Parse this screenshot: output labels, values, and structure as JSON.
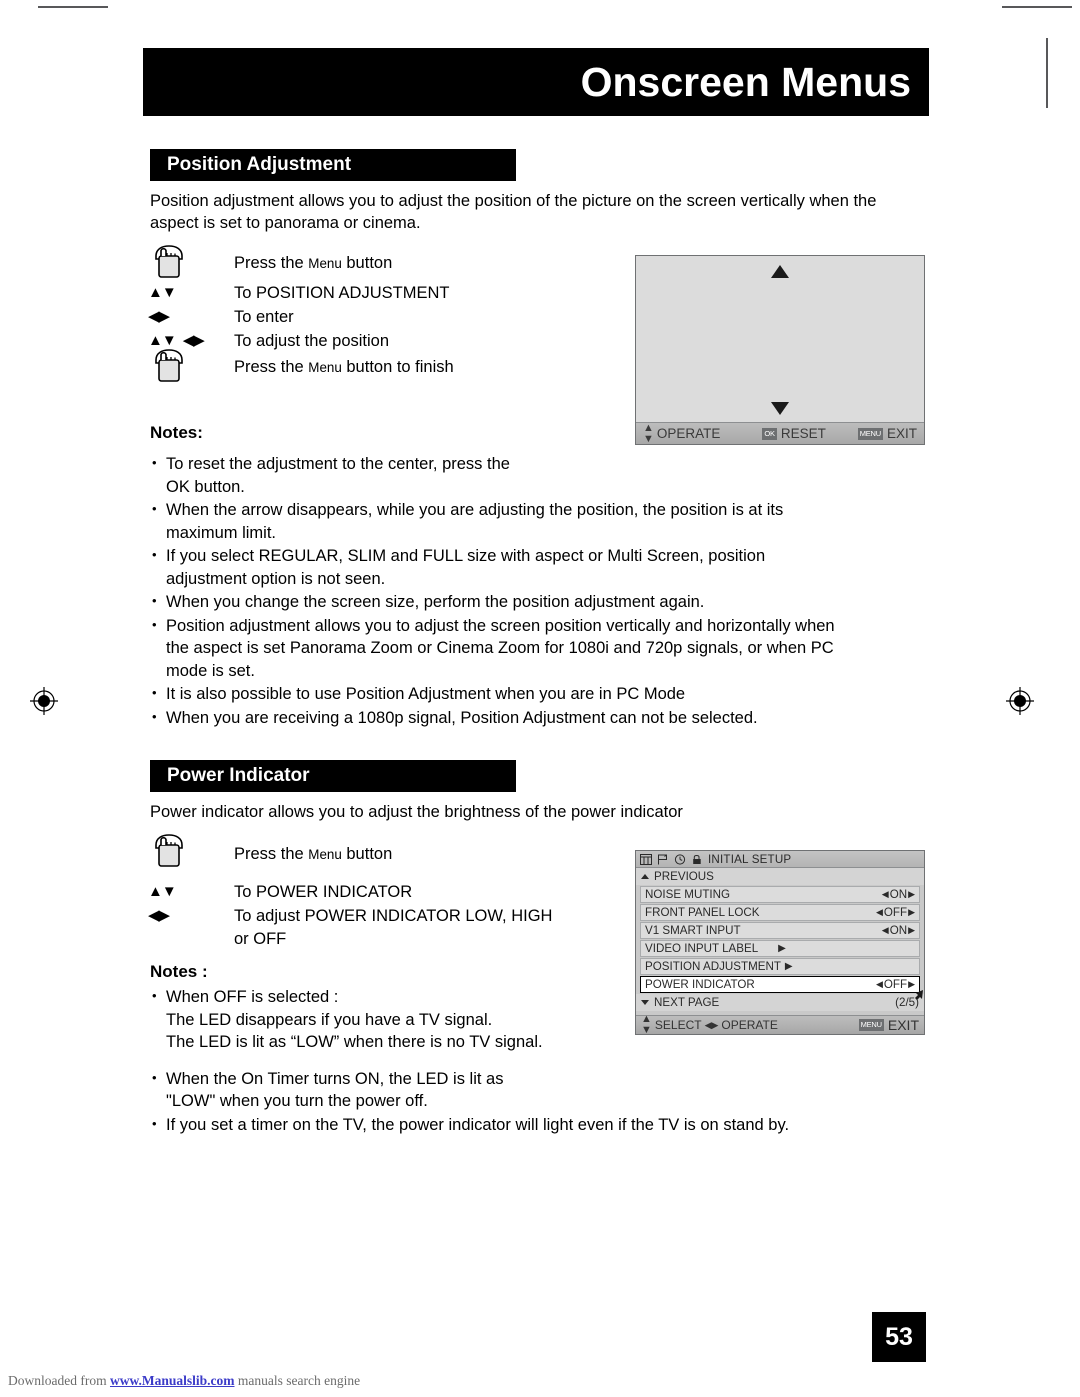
{
  "page": {
    "banner_title": "Onscreen Menus",
    "page_number": "53",
    "footer_prefix": "Downloaded from ",
    "footer_link": "www.Manualslib.com",
    "footer_suffix": " manuals search engine"
  },
  "section_position": {
    "heading": "Position Adjustment",
    "intro": "Position adjustment allows you to adjust the position of the picture on the screen vertically when the aspect is set to panorama or cinema.",
    "steps": [
      {
        "icon": "hand-press-icon",
        "text_pre": "Press the ",
        "text_sc": "Menu",
        "text_post": " button"
      },
      {
        "icon": "up-down-arrows-icon",
        "text": "To POSITION ADJUSTMENT"
      },
      {
        "icon": "left-right-arrows-icon",
        "text": "To enter"
      },
      {
        "icon": "four-way-arrows-icon",
        "text": "To adjust the position"
      },
      {
        "icon": "hand-press-icon",
        "text_pre": "Press the ",
        "text_sc": "Menu",
        "text_post": " button to finish"
      }
    ],
    "notes_title": "Notes:",
    "notes": [
      "To reset the adjustment to the center, press the\nOK button.",
      "When the arrow disappears, while you are adjusting the position, the position is at its\nmaximum limit.",
      "If you select REGULAR, SLIM and FULL size with aspect or Multi Screen, position\nadjustment option is not seen.",
      "When you change the screen size, perform the position adjustment again.",
      "Position adjustment allows you to adjust the screen position vertically and horizontally when\nthe aspect is set Panorama Zoom or Cinema Zoom for 1080i and 720p signals, or when PC\nmode is set.",
      "It is also possible to use Position Adjustment when you are in PC Mode",
      "When you are receiving a 1080p signal, Position Adjustment can not be selected."
    ]
  },
  "osd_position_screen": {
    "arrow_up": "up-arrow-indicator",
    "arrow_down": "down-arrow-indicator",
    "bar": {
      "operate_label": "OPERATE",
      "reset_key": "OK",
      "reset_label": "RESET",
      "exit_key": "MENU",
      "exit_label": "EXIT"
    }
  },
  "section_power": {
    "heading": "Power Indicator",
    "intro": "Power indicator allows you to adjust the brightness of the power indicator",
    "steps": [
      {
        "icon": "hand-press-icon",
        "text_pre": "Press the ",
        "text_sc": "Menu",
        "text_post": " button"
      },
      {
        "icon": "up-down-arrows-icon",
        "text": "To POWER INDICATOR"
      },
      {
        "icon": "left-right-arrows-icon",
        "text": "To adjust POWER INDICATOR LOW, HIGH\nor OFF"
      }
    ],
    "notes_title": "Notes :",
    "notes": [
      "When OFF is selected :\nThe LED disappears if you have a TV signal.\nThe LED is lit as “LOW” when there is no TV signal.",
      "When the On Timer turns ON, the LED is lit as\n\"LOW\" when you turn the power off.",
      "If you set a timer on the TV, the power indicator will light even if the TV is on stand by."
    ]
  },
  "osd_initial_setup": {
    "title": "INITIAL SETUP",
    "tab_icons": [
      "picture-tab-icon",
      "flag-tab-icon",
      "clock-tab-icon",
      "lock-tab-icon"
    ],
    "previous_label": "PREVIOUS",
    "rows": [
      {
        "label": "NOISE MUTING",
        "value": "ON",
        "type": "option",
        "highlight": false
      },
      {
        "label": "FRONT PANEL LOCK",
        "value": "OFF",
        "type": "option",
        "highlight": false
      },
      {
        "label": "V1 SMART INPUT",
        "value": "ON",
        "type": "option",
        "highlight": false
      },
      {
        "label": "VIDEO INPUT LABEL",
        "value": "",
        "type": "submenu",
        "highlight": false
      },
      {
        "label": "POSITION ADJUSTMENT",
        "value": "",
        "type": "submenu",
        "highlight": false
      },
      {
        "label": "POWER INDICATOR",
        "value": "OFF",
        "type": "option",
        "highlight": true
      }
    ],
    "next_page_label": "NEXT PAGE",
    "page_indicator": "(2/5)",
    "bottom": {
      "select_label": "SELECT",
      "operate_label": "OPERATE",
      "exit_key": "MENU",
      "exit_label": "EXIT"
    }
  }
}
